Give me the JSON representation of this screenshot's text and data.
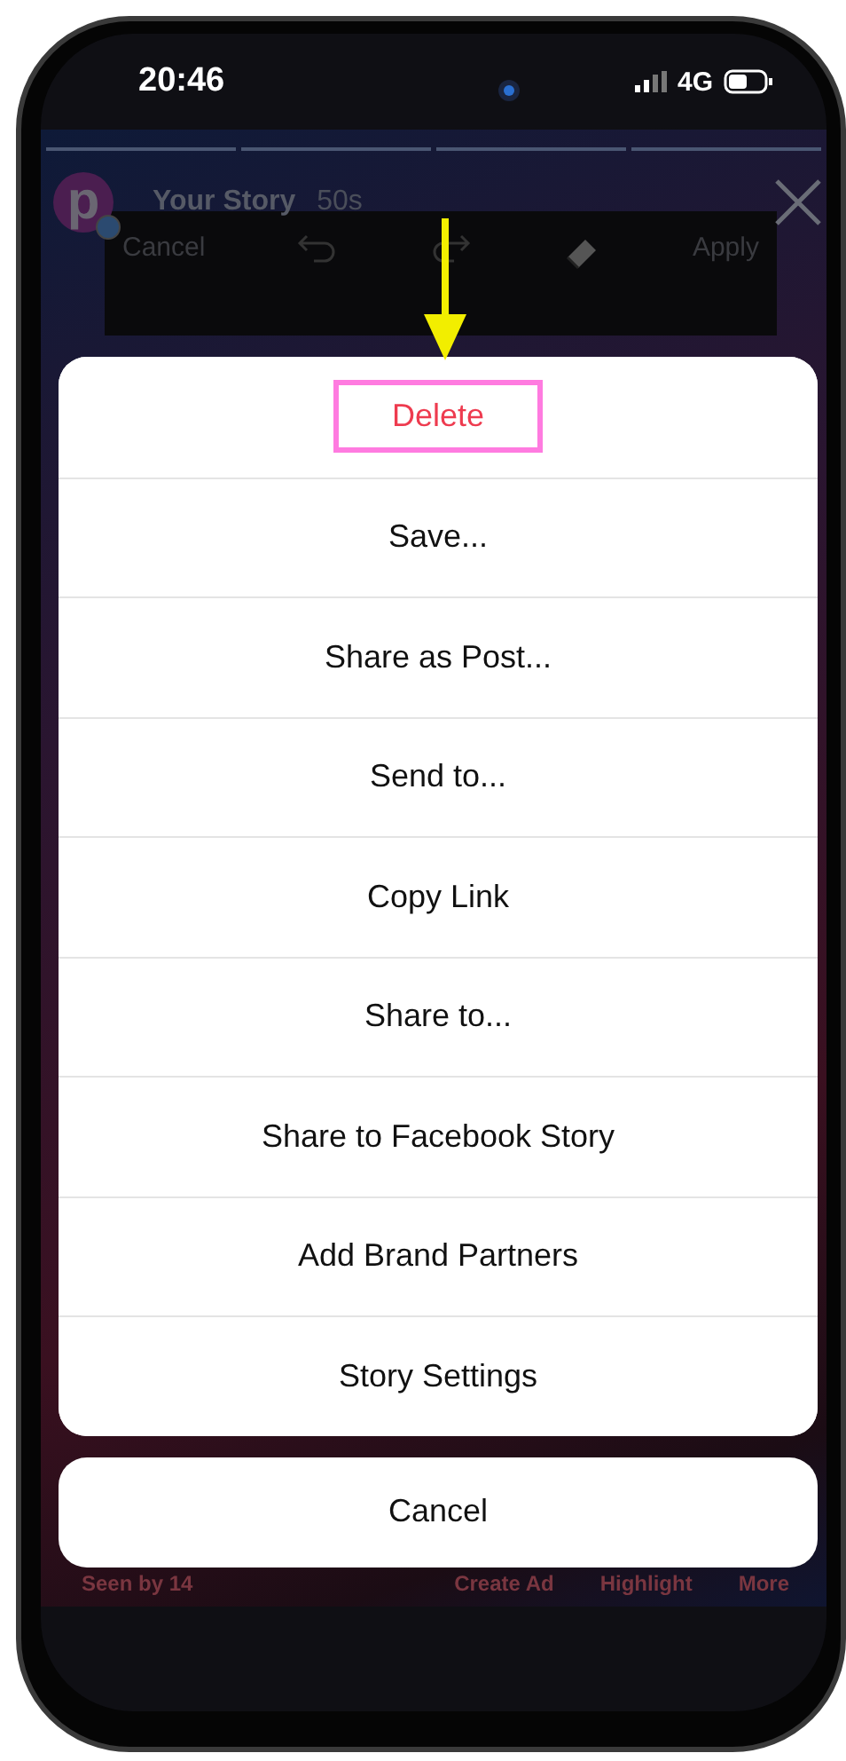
{
  "status_bar": {
    "time": "20:46",
    "network": "4G"
  },
  "story": {
    "avatar_letter": "p",
    "title": "Your Story",
    "age": "50s"
  },
  "editor_bar": {
    "cancel": "Cancel",
    "apply": "Apply"
  },
  "footer": [
    {
      "label": "Seen by 14"
    },
    {
      "label": "Create Ad"
    },
    {
      "label": "Highlight"
    },
    {
      "label": "More"
    }
  ],
  "action_sheet": {
    "items": [
      {
        "label": "Delete",
        "kind": "destructive",
        "highlighted": true
      },
      {
        "label": "Save...",
        "kind": "default",
        "highlighted": false
      },
      {
        "label": "Share as Post...",
        "kind": "default",
        "highlighted": false
      },
      {
        "label": "Send to...",
        "kind": "default",
        "highlighted": false
      },
      {
        "label": "Copy Link",
        "kind": "default",
        "highlighted": false
      },
      {
        "label": "Share to...",
        "kind": "default",
        "highlighted": false
      },
      {
        "label": "Share to Facebook Story",
        "kind": "default",
        "highlighted": false
      },
      {
        "label": "Add Brand Partners",
        "kind": "default",
        "highlighted": false
      },
      {
        "label": "Story Settings",
        "kind": "default",
        "highlighted": false
      }
    ],
    "cancel": "Cancel"
  }
}
